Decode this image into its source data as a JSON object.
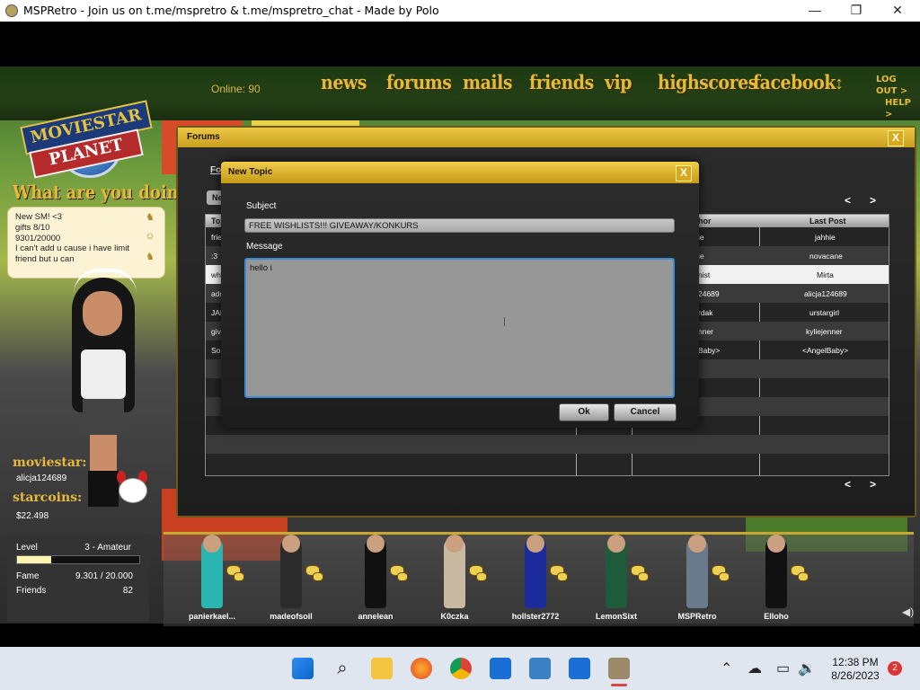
{
  "window": {
    "title": "MSPRetro - Join us on t.me/mspretro & t.me/mspretro_chat - Made by Polo",
    "minimize": "—",
    "maximize": "❐",
    "close": "✕"
  },
  "nav": {
    "online": "Online: 90",
    "items": [
      "news",
      "forums",
      "mails",
      "friends",
      "vip",
      "highscores",
      "facebook"
    ],
    "updown": "↕",
    "logout": "LOG OUT >",
    "help": "HELP >"
  },
  "logo": {
    "line1": "MOVIESTAR",
    "line2": "PLANET"
  },
  "status": {
    "heading": "What are you doing?",
    "lines": [
      "New SM! <3",
      "gifts 8/10",
      "9301/20000",
      "I can't add u cause i have limit",
      "friend but u can"
    ]
  },
  "profile": {
    "moviestar_label": "moviestar:",
    "moviestar_name": "alicja124689",
    "starcoins_label": "starcoins:",
    "starcoins": "$22.498"
  },
  "stats": {
    "level_label": "Level",
    "level_value": "3 - Amateur",
    "level_progress": 0.28,
    "fame_label": "Fame",
    "fame_value": "9.301 / 20.000",
    "friends_label": "Friends",
    "friends_value": "82"
  },
  "forums": {
    "title": "Forums",
    "close": "X",
    "breadcrumb": "Forums",
    "new_button": "Ne",
    "pager_prev": "<",
    "pager_next": ">",
    "columns": [
      "Top",
      "hor",
      "Last Post"
    ],
    "rows": [
      {
        "topic": "frie",
        "author": "ie",
        "last": "jahhie"
      },
      {
        "topic": ":3",
        "author": "ie",
        "last": "novacane"
      },
      {
        "topic": "why",
        "author": "nist",
        "last": "Mirta"
      },
      {
        "topic": "add",
        "author": "24689",
        "last": "alicja124689"
      },
      {
        "topic": "JAK",
        "author": "rdak",
        "last": "urstargirl"
      },
      {
        "topic": "give",
        "author": "nner",
        "last": "kyliejenner"
      },
      {
        "topic": "Son",
        "author": "Baby>",
        "last": "<AngelBaby>"
      }
    ]
  },
  "dialog": {
    "title": "New Topic",
    "close": "X",
    "subject_label": "Subject",
    "subject_value": "FREE WISHLISTS!!! GIVEAWAY/KONKURS",
    "message_label": "Message",
    "message_value": "hello i",
    "ok": "Ok",
    "cancel": "Cancel"
  },
  "friends_strip": [
    {
      "name": "panierkael...",
      "color": "#2bb5b0"
    },
    {
      "name": "madeofsoil",
      "color": "#2b2b2b"
    },
    {
      "name": "annelean",
      "color": "#111111"
    },
    {
      "name": "K0czka",
      "color": "#c9b9a0"
    },
    {
      "name": "hollster2772",
      "color": "#1c2c9c"
    },
    {
      "name": "LemonSixt",
      "color": "#1f5a3a"
    },
    {
      "name": "MSPRetro",
      "color": "#6a7a8a"
    },
    {
      "name": "Elloho",
      "color": "#111111"
    }
  ],
  "taskbar": {
    "time": "12:38 PM",
    "date": "8/26/2023",
    "notifications": "2",
    "icons": [
      "windows-start-icon",
      "search-icon",
      "file-explorer-icon",
      "firefox-icon",
      "chrome-icon",
      "shield-app-icon",
      "network-monitor-icon",
      "shield-app-icon-2",
      "mspretro-icon"
    ]
  },
  "colors": {
    "accent_gold": "#e6b93b",
    "dialog_border": "#3a8ad8",
    "notif_badge": "#dd3333"
  }
}
